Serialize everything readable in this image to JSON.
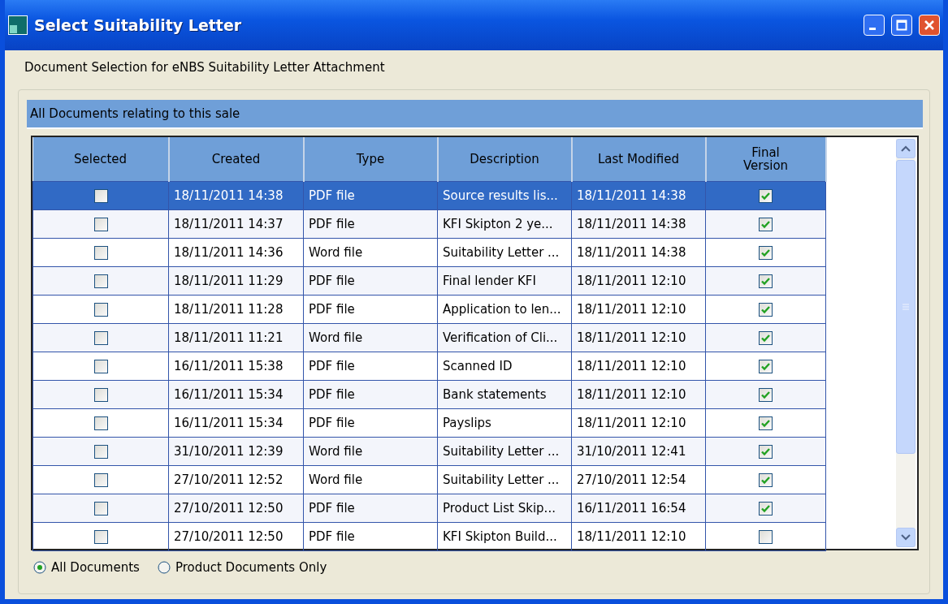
{
  "window": {
    "title": "Select Suitability Letter"
  },
  "heading": "Document Selection for eNBS  Suitability Letter Attachment",
  "group": {
    "title": "All Documents relating to this sale"
  },
  "table": {
    "columns": [
      "Selected",
      "Created",
      "Type",
      "Description",
      "Last Modified",
      "Final Version"
    ],
    "rows": [
      {
        "selected": true,
        "checked": false,
        "created": "18/11/2011 14:38",
        "type": "PDF file",
        "description": "Source results lis...",
        "modified": "18/11/2011 14:38",
        "final": true
      },
      {
        "selected": false,
        "checked": false,
        "created": "18/11/2011 14:37",
        "type": "PDF file",
        "description": "KFI Skipton 2 ye...",
        "modified": "18/11/2011 14:38",
        "final": true
      },
      {
        "selected": false,
        "checked": false,
        "created": "18/11/2011 14:36",
        "type": "Word file",
        "description": "Suitability Letter ...",
        "modified": "18/11/2011 14:38",
        "final": true
      },
      {
        "selected": false,
        "checked": false,
        "created": "18/11/2011 11:29",
        "type": "PDF file",
        "description": "Final lender KFI",
        "modified": "18/11/2011 12:10",
        "final": true
      },
      {
        "selected": false,
        "checked": false,
        "created": "18/11/2011 11:28",
        "type": "PDF file",
        "description": "Application to len...",
        "modified": "18/11/2011 12:10",
        "final": true
      },
      {
        "selected": false,
        "checked": false,
        "created": "18/11/2011 11:21",
        "type": "Word file",
        "description": "Verification of Cli...",
        "modified": "18/11/2011 12:10",
        "final": true
      },
      {
        "selected": false,
        "checked": false,
        "created": "16/11/2011 15:38",
        "type": "PDF file",
        "description": "Scanned ID",
        "modified": "18/11/2011 12:10",
        "final": true
      },
      {
        "selected": false,
        "checked": false,
        "created": "16/11/2011 15:34",
        "type": "PDF file",
        "description": "Bank statements",
        "modified": "18/11/2011 12:10",
        "final": true
      },
      {
        "selected": false,
        "checked": false,
        "created": "16/11/2011 15:34",
        "type": "PDF file",
        "description": "Payslips",
        "modified": "18/11/2011 12:10",
        "final": true
      },
      {
        "selected": false,
        "checked": false,
        "created": "31/10/2011 12:39",
        "type": "Word file",
        "description": "Suitability Letter ...",
        "modified": "31/10/2011 12:41",
        "final": true
      },
      {
        "selected": false,
        "checked": false,
        "created": "27/10/2011 12:52",
        "type": "Word file",
        "description": "Suitability Letter ...",
        "modified": "27/10/2011 12:54",
        "final": true
      },
      {
        "selected": false,
        "checked": false,
        "created": "27/10/2011 12:50",
        "type": "PDF file",
        "description": "Product List Skip...",
        "modified": "16/11/2011 16:54",
        "final": true
      },
      {
        "selected": false,
        "checked": false,
        "created": "27/10/2011 12:50",
        "type": "PDF file",
        "description": "KFI Skipton Build...",
        "modified": "18/11/2011 12:10",
        "final": false
      }
    ]
  },
  "filters": [
    {
      "label": "All Documents",
      "selected": true
    },
    {
      "label": "Product Documents Only",
      "selected": false
    }
  ]
}
